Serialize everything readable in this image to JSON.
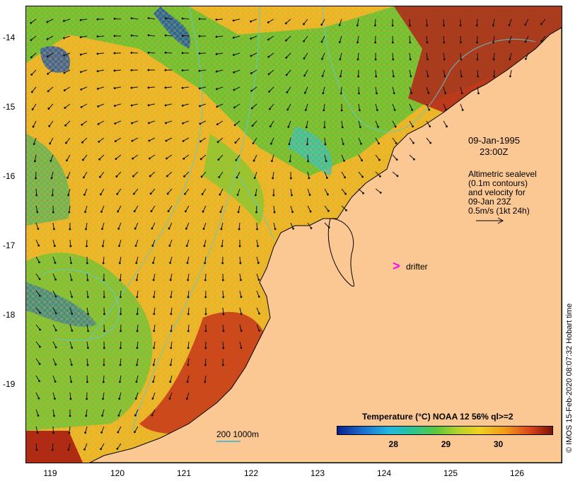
{
  "map": {
    "date_line1": "09-Jan-1995",
    "date_line2": "23:00Z",
    "altimetry_lines": [
      "Altimetric sealevel",
      "(0.1m contours)",
      "and velocity for",
      "09-Jan 23Z",
      "0.5m/s (1kt 24h)"
    ],
    "drifter_symbol": ">",
    "drifter_label": "drifter",
    "scale_label": "200  1000m",
    "credit": "© IMOS 15-Feb-2020 08:07:32 Hobart time",
    "latitude_labels": [
      "-14",
      "-15",
      "-16",
      "-17",
      "-18",
      "-19"
    ],
    "longitude_labels": [
      "119",
      "120",
      "121",
      "122",
      "123",
      "124",
      "125",
      "126"
    ],
    "land_color": "#fbc793",
    "drifter_color": "#ff00ff",
    "contour_color": "#5fc9d6"
  },
  "colorbar": {
    "title": "Temperature (°C) NOAA 12 56% ql>=2",
    "tick_labels": [
      "28",
      "29",
      "30"
    ],
    "tick_values": [
      28,
      29,
      30
    ],
    "range": [
      26.9,
      31.0
    ]
  }
}
